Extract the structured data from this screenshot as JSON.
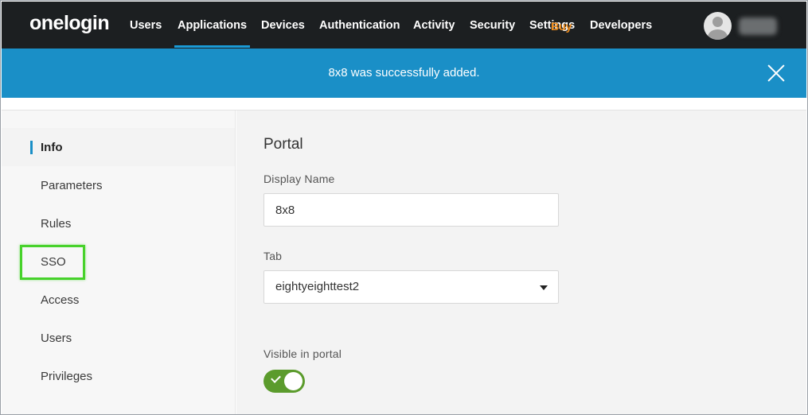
{
  "brand": {
    "logo_text": "onelogin"
  },
  "nav": {
    "items": [
      {
        "label": "Users"
      },
      {
        "label": "Applications",
        "active": true
      },
      {
        "label": "Devices"
      },
      {
        "label": "Authentication"
      },
      {
        "label": "Activity"
      },
      {
        "label": "Security"
      },
      {
        "label": "Settings"
      },
      {
        "label": "Developers"
      }
    ],
    "overlay_text": "Buy"
  },
  "user": {
    "avatar_icon": "user-avatar-icon"
  },
  "banner": {
    "message": "8x8 was successfully added.",
    "close_icon": "close-icon",
    "color": "#1a8fc7"
  },
  "sidebar": {
    "items": [
      {
        "label": "Info",
        "active": true
      },
      {
        "label": "Parameters"
      },
      {
        "label": "Rules"
      },
      {
        "label": "SSO"
      },
      {
        "label": "Access"
      },
      {
        "label": "Users"
      },
      {
        "label": "Privileges"
      }
    ]
  },
  "main": {
    "section_title": "Portal",
    "display_name": {
      "label": "Display Name",
      "value": "8x8"
    },
    "tab": {
      "label": "Tab",
      "value": "eightyeighttest2"
    },
    "visible_in_portal": {
      "label": "Visible in portal",
      "enabled": true
    }
  },
  "colors": {
    "topnav": "#1c1f21",
    "accent": "#1a9bd7",
    "toggle_on": "#5b9b2c",
    "highlight": "#47d22b"
  }
}
